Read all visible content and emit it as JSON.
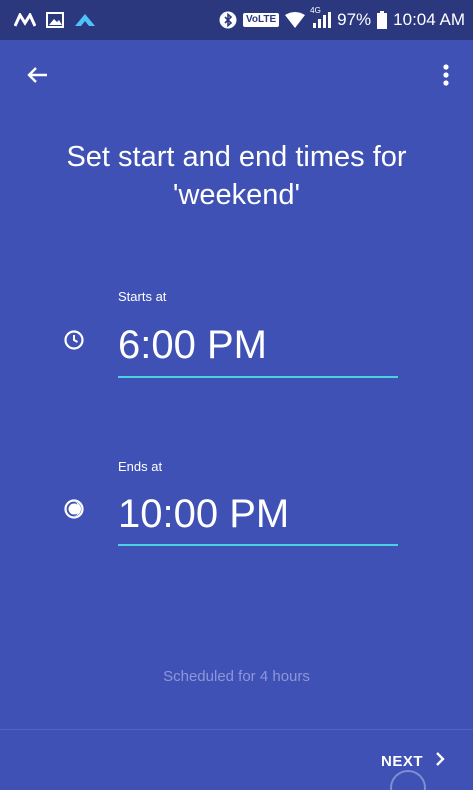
{
  "status_bar": {
    "left_icons": [
      "maps-icon",
      "gallery-icon",
      "app-notification-icon"
    ],
    "volte": "VoLTE",
    "network_type": "4G",
    "battery": "97%",
    "time": "10:04 AM"
  },
  "app_bar": {
    "back_icon": "arrow-left-icon",
    "more_icon": "more-vert-icon"
  },
  "title": {
    "line1": "Set start and end times for",
    "line2": "'weekend'"
  },
  "start": {
    "label": "Starts at",
    "value": "6:00 PM",
    "icon": "clock-icon"
  },
  "end": {
    "label": "Ends at",
    "value": "10:00 PM",
    "icon": "moon-clock-icon"
  },
  "summary": "Scheduled for 4 hours",
  "footer": {
    "next_label": "NEXT"
  },
  "colors": {
    "background": "#3f51b5",
    "status_bar": "#2c387e",
    "accent_underline": "#4dd0e1",
    "muted_text": "#8c97d9"
  }
}
